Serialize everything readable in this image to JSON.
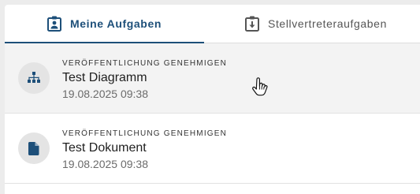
{
  "tabs": [
    {
      "label": "Meine Aufgaben",
      "icon": "assignment-ind-icon",
      "active": true
    },
    {
      "label": "Stellvertreteraufgaben",
      "icon": "download-box-icon",
      "active": false
    }
  ],
  "tasks": [
    {
      "type": "Veröffentlichung genehmigen",
      "title": "Test Diagramm",
      "date": "19.08.2025 09:38",
      "icon": "diagram-icon"
    },
    {
      "type": "Veröffentlichung genehmigen",
      "title": "Test Dokument",
      "date": "19.08.2025 09:38",
      "icon": "document-icon"
    }
  ],
  "colors": {
    "accent": "#1d4f79",
    "icon": "#1d4f79",
    "hover_bg": "#f3f3f3"
  }
}
